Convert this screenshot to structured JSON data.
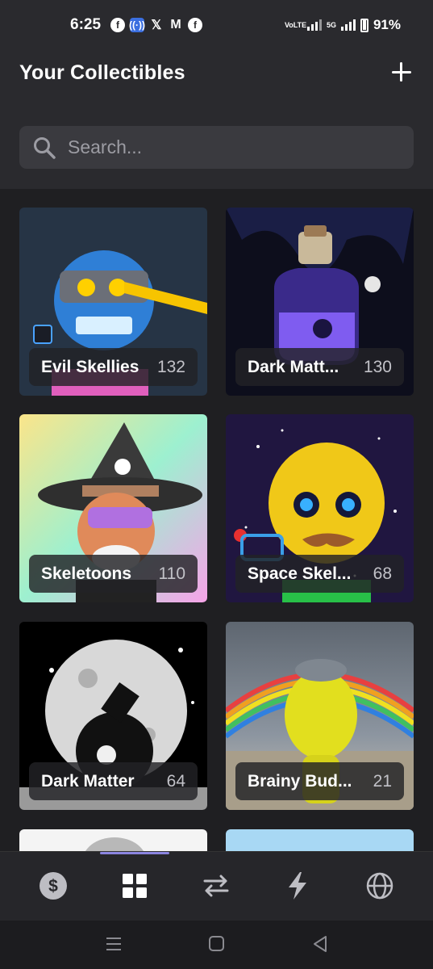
{
  "status_bar": {
    "time": "6:25",
    "notification_icons": [
      "facebook-icon",
      "radio-icon",
      "x-icon",
      "gmail-icon",
      "facebook-icon"
    ],
    "volte_label": "VoLTE",
    "network_label": "5G",
    "battery": "91%"
  },
  "header": {
    "title": "Your Collectibles",
    "add_icon": "plus-icon"
  },
  "search": {
    "placeholder": "Search..."
  },
  "collections": [
    {
      "name": "Evil Skellies",
      "count": "132",
      "colors": [
        "#1e2b3f",
        "#4aa3e8",
        "#f2b705"
      ]
    },
    {
      "name": "Dark Matt...",
      "count": "130",
      "colors": [
        "#0f0f1e",
        "#5b3fb8",
        "#9a7bf0"
      ]
    },
    {
      "name": "Skeletoons",
      "count": "110",
      "colors": [
        "#f8a8e0",
        "#9be8d0",
        "#fbe8a0"
      ]
    },
    {
      "name": "Space Skel...",
      "count": "68",
      "colors": [
        "#1b1440",
        "#f0d020",
        "#3a9fe8"
      ]
    },
    {
      "name": "Dark Matter",
      "count": "64",
      "colors": [
        "#000000",
        "#ffffff",
        "#888888"
      ]
    },
    {
      "name": "Brainy Bud...",
      "count": "21",
      "colors": [
        "#6f7680",
        "#e5e02a",
        "#3d5060"
      ]
    }
  ],
  "bottom_nav": {
    "items": [
      "dollar-icon",
      "grid-icon",
      "swap-icon",
      "lightning-icon",
      "globe-icon"
    ],
    "active": "grid-icon",
    "accent": "#8b85e0"
  },
  "system_nav": [
    "recents-icon",
    "home-icon",
    "back-icon"
  ]
}
